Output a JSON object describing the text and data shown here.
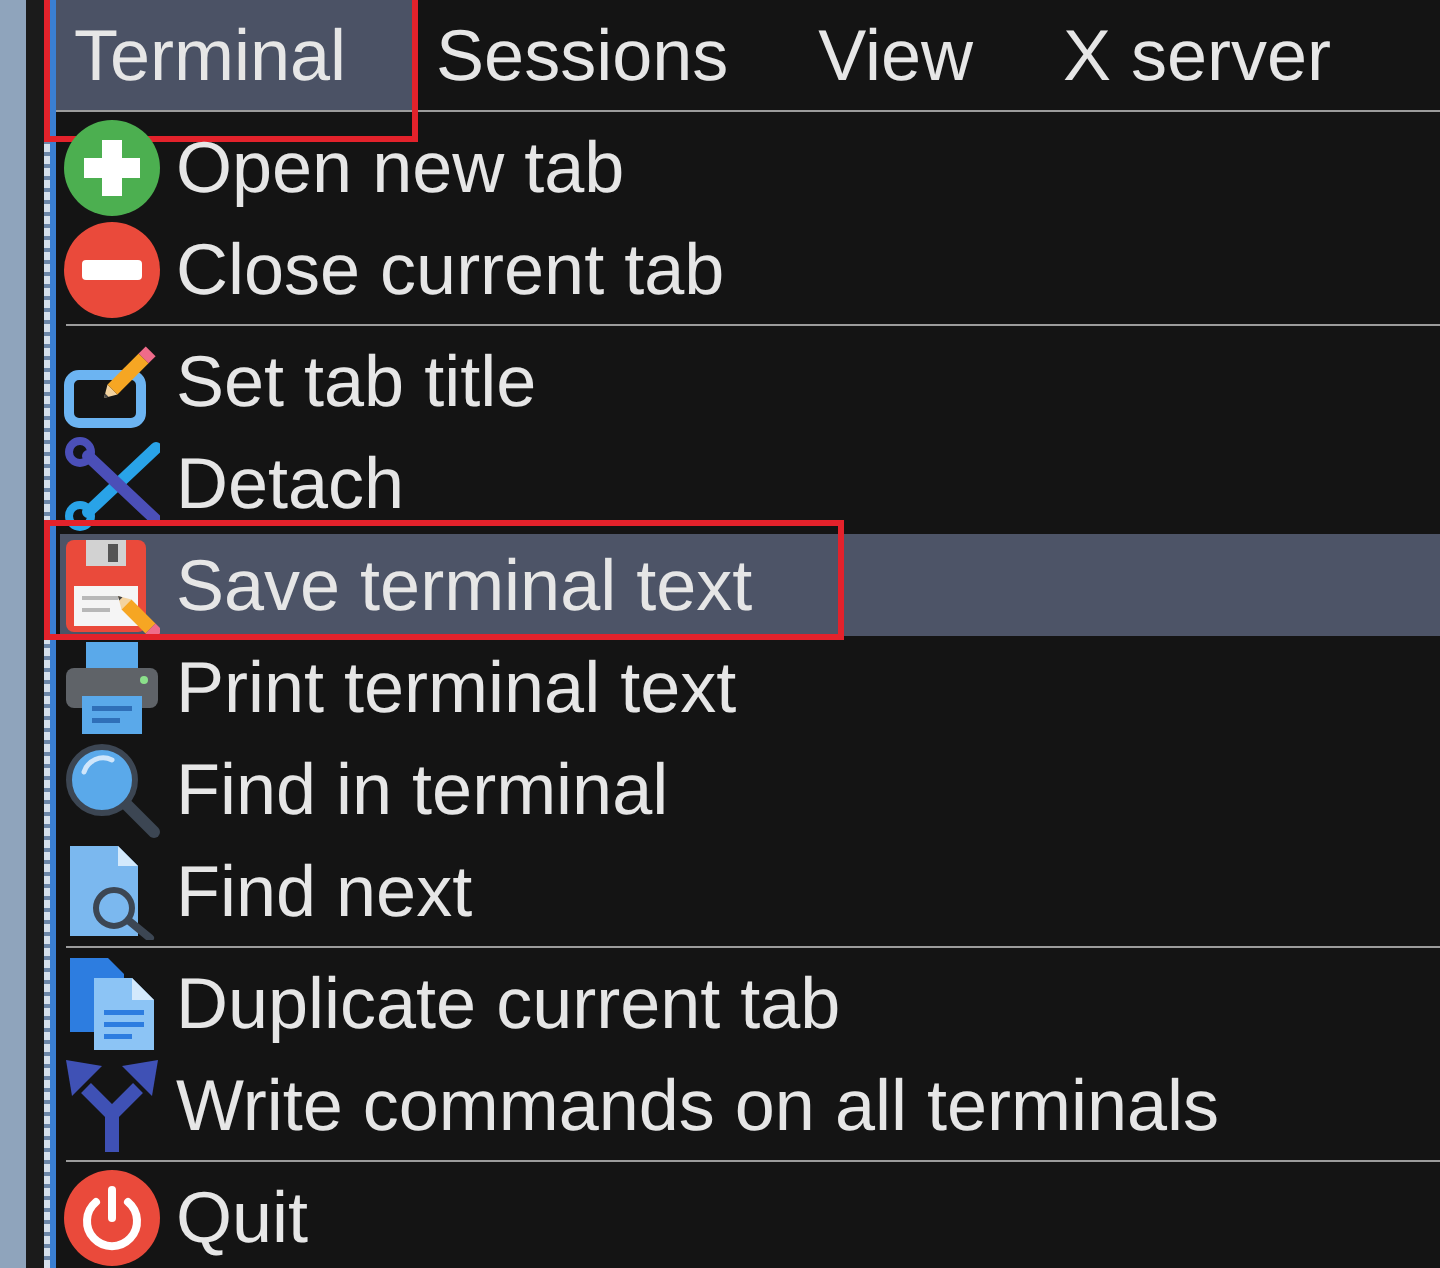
{
  "menu_bar": [
    {
      "label": "Terminal",
      "selected": true,
      "annotated": true
    },
    {
      "label": "Sessions",
      "selected": false,
      "annotated": false
    },
    {
      "label": "View",
      "selected": false,
      "annotated": false
    },
    {
      "label": "X server",
      "selected": false,
      "annotated": false
    }
  ],
  "menu": {
    "sections": [
      {
        "items": [
          {
            "label": "Open new tab",
            "selected": false,
            "annotated": false
          },
          {
            "label": "Close current tab",
            "selected": false,
            "annotated": false
          }
        ]
      },
      {
        "items": [
          {
            "label": "Set tab title",
            "selected": false,
            "annotated": false
          },
          {
            "label": "Detach",
            "selected": false,
            "annotated": false
          },
          {
            "label": "Save terminal text",
            "selected": true,
            "annotated": true
          },
          {
            "label": "Print terminal text",
            "selected": false,
            "annotated": false
          },
          {
            "label": "Find in terminal",
            "selected": false,
            "annotated": false
          },
          {
            "label": "Find next",
            "selected": false,
            "annotated": false
          }
        ]
      },
      {
        "items": [
          {
            "label": "Duplicate current tab",
            "selected": false,
            "annotated": false
          },
          {
            "label": "Write commands on all terminals",
            "selected": false,
            "annotated": false
          }
        ]
      },
      {
        "items": [
          {
            "label": "Quit",
            "selected": false,
            "annotated": false
          }
        ]
      }
    ]
  }
}
